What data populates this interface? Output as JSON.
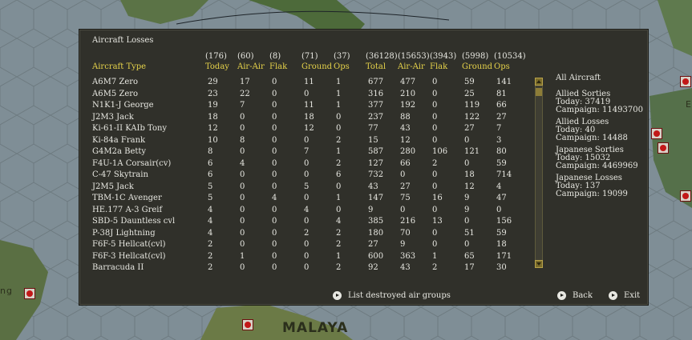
{
  "map": {
    "region_label": "MALAYA",
    "edge_label_left": "ng",
    "edge_label_right": "E"
  },
  "dialog": {
    "title": "Aircraft Losses",
    "columns": [
      {
        "total": "(176)",
        "label": "Today"
      },
      {
        "total": "(60)",
        "label": "Air-Air"
      },
      {
        "total": "(8)",
        "label": "Flak"
      },
      {
        "total": "(71)",
        "label": "Ground"
      },
      {
        "total": "(37)",
        "label": "Ops"
      },
      {
        "total": "(36128)",
        "label": "Total"
      },
      {
        "total": "(15653)",
        "label": "Air-Air"
      },
      {
        "total": "(3943)",
        "label": "Flak"
      },
      {
        "total": "(5998)",
        "label": "Ground"
      },
      {
        "total": "(10534)",
        "label": "Ops"
      }
    ],
    "type_header": "Aircraft Type",
    "rows": [
      {
        "name": "A6M7 Zero",
        "v": [
          "29",
          "17",
          "0",
          "11",
          "1",
          "677",
          "477",
          "0",
          "59",
          "141"
        ]
      },
      {
        "name": "A6M5 Zero",
        "v": [
          "23",
          "22",
          "0",
          "0",
          "1",
          "316",
          "210",
          "0",
          "25",
          "81"
        ]
      },
      {
        "name": "N1K1-J George",
        "v": [
          "19",
          "7",
          "0",
          "11",
          "1",
          "377",
          "192",
          "0",
          "119",
          "66"
        ]
      },
      {
        "name": "J2M3 Jack",
        "v": [
          "18",
          "0",
          "0",
          "18",
          "0",
          "237",
          "88",
          "0",
          "122",
          "27"
        ]
      },
      {
        "name": "Ki-61-II KAIb Tony",
        "v": [
          "12",
          "0",
          "0",
          "12",
          "0",
          "77",
          "43",
          "0",
          "27",
          "7"
        ]
      },
      {
        "name": "Ki-84a Frank",
        "v": [
          "10",
          "8",
          "0",
          "0",
          "2",
          "15",
          "12",
          "0",
          "0",
          "3"
        ]
      },
      {
        "name": "G4M2a Betty",
        "v": [
          "8",
          "0",
          "0",
          "7",
          "1",
          "587",
          "280",
          "106",
          "121",
          "80"
        ]
      },
      {
        "name": "F4U-1A Corsair(cv)",
        "v": [
          "6",
          "4",
          "0",
          "0",
          "2",
          "127",
          "66",
          "2",
          "0",
          "59"
        ]
      },
      {
        "name": "C-47 Skytrain",
        "v": [
          "6",
          "0",
          "0",
          "0",
          "6",
          "732",
          "0",
          "0",
          "18",
          "714"
        ]
      },
      {
        "name": "J2M5 Jack",
        "v": [
          "5",
          "0",
          "0",
          "5",
          "0",
          "43",
          "27",
          "0",
          "12",
          "4"
        ]
      },
      {
        "name": "TBM-1C Avenger",
        "v": [
          "5",
          "0",
          "4",
          "0",
          "1",
          "147",
          "75",
          "16",
          "9",
          "47"
        ]
      },
      {
        "name": "HE.177 A-3 Greif",
        "v": [
          "4",
          "0",
          "0",
          "4",
          "0",
          "9",
          "0",
          "0",
          "9",
          "0"
        ]
      },
      {
        "name": "SBD-5 Dauntless cvl",
        "v": [
          "4",
          "0",
          "0",
          "0",
          "4",
          "385",
          "216",
          "13",
          "0",
          "156"
        ]
      },
      {
        "name": "P-38J Lightning",
        "v": [
          "4",
          "0",
          "0",
          "2",
          "2",
          "180",
          "70",
          "0",
          "51",
          "59"
        ]
      },
      {
        "name": "F6F-5 Hellcat(cvl)",
        "v": [
          "2",
          "0",
          "0",
          "0",
          "2",
          "27",
          "9",
          "0",
          "0",
          "18"
        ]
      },
      {
        "name": "F6F-3 Hellcat(cvl)",
        "v": [
          "2",
          "1",
          "0",
          "0",
          "1",
          "600",
          "363",
          "1",
          "65",
          "171"
        ]
      },
      {
        "name": "Barracuda II",
        "v": [
          "2",
          "0",
          "0",
          "0",
          "2",
          "92",
          "43",
          "2",
          "17",
          "30"
        ]
      }
    ],
    "side": {
      "filter_label": "All Aircraft",
      "allied_sorties": {
        "title": "Allied Sorties",
        "today": "Today:   37419",
        "campaign": "Campaign: 11493700"
      },
      "allied_losses": {
        "title": "Allied Losses",
        "today": "Today:   40",
        "campaign": "Campaign: 14488"
      },
      "japanese_sorties": {
        "title": "Japanese Sorties",
        "today": "Today:   15032",
        "campaign": "Campaign: 4469969"
      },
      "japanese_losses": {
        "title": "Japanese Losses",
        "today": "Today:   137",
        "campaign": "Campaign: 19099"
      }
    },
    "buttons": {
      "list_destroyed": "List destroyed air groups",
      "back": "Back",
      "exit": "Exit"
    }
  },
  "colors": {
    "panel_bg": "#30302a",
    "header_yellow": "#e5d24a",
    "text": "#e8e8e2"
  }
}
